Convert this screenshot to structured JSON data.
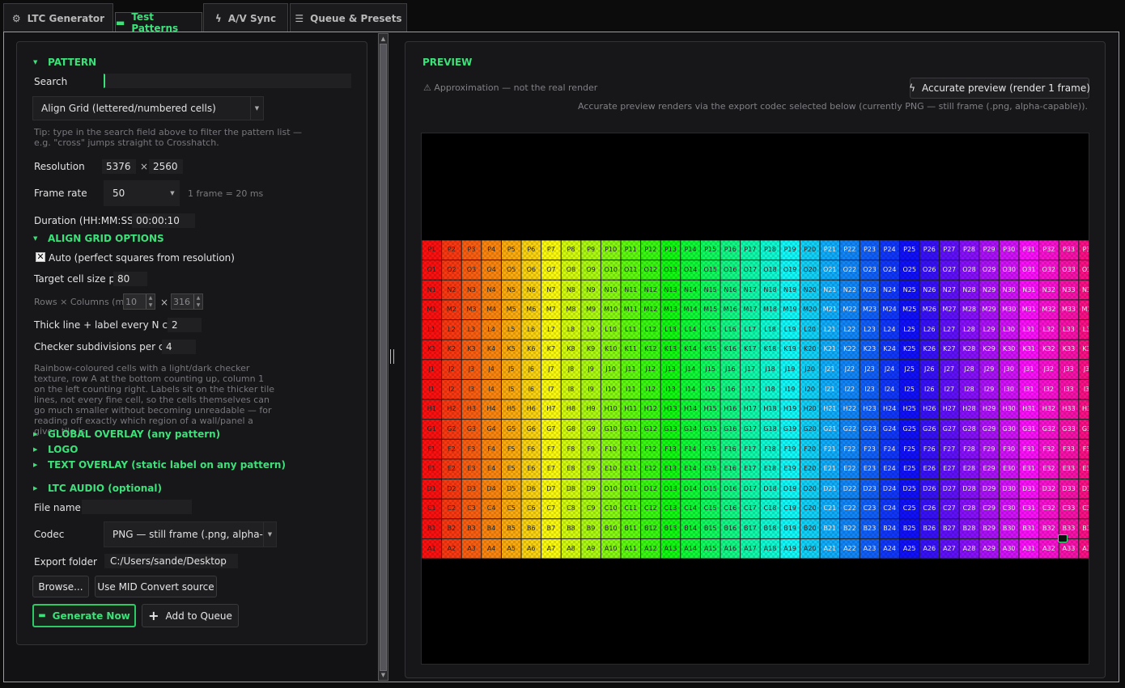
{
  "tabs": [
    {
      "label": "LTC Generator",
      "icon": "gear-icon",
      "active": false
    },
    {
      "label": "Test Patterns",
      "icon": "pattern-icon",
      "active": true
    },
    {
      "label": "A/V Sync",
      "icon": "bolt-icon",
      "active": false
    },
    {
      "label": "Queue & Presets",
      "icon": "list-icon",
      "active": false
    }
  ],
  "pattern": {
    "section_title": "PATTERN",
    "search_label": "Search",
    "search_value": "",
    "pattern_select": "Align Grid (lettered/numbered cells)",
    "tip": "Tip: type in the search field above to filter the pattern list — e.g. \"cross\" jumps straight to Crosshatch.",
    "resolution_label": "Resolution",
    "res_w": "5376",
    "res_x": "×",
    "res_h": "2560",
    "framerate_label": "Frame rate",
    "framerate": "50",
    "frame_hint": "1 frame = 20 ms",
    "duration_label": "Duration (HH:MM:SS)",
    "duration": "00:00:10"
  },
  "align": {
    "section_title": "ALIGN GRID OPTIONS",
    "auto_label": "Auto (perfect squares from resolution)",
    "auto_checked": true,
    "target_label": "Target cell size px",
    "target_value": "80",
    "rowscols_label": "Rows × Columns (ma",
    "rows": "10",
    "cols_x": "×",
    "cols": "316",
    "thick_label": "Thick line + label every N cells",
    "thick_value": "2",
    "checker_label": "Checker subdivisions per cell",
    "checker_value": "4",
    "description": "Rainbow-coloured cells with a light/dark checker texture, row A at the bottom counting up, column 1 on the left counting right. Labels sit on the thicker tile lines, not every fine cell, so the cells themselves can go much smaller without becoming unreadable — for reading off exactly which region of a wall/panel a given tile is."
  },
  "collapsed_sections": [
    "GLOBAL OVERLAY (any pattern)",
    "LOGO",
    "TEXT OVERLAY (static label on any pattern)"
  ],
  "ltc": {
    "section_title": "LTC AUDIO (optional)",
    "filename_label": "File name",
    "filename_value": "",
    "codec_label": "Codec",
    "codec_value": "PNG — still frame (.png, alpha-cap",
    "export_label": "Export folder",
    "export_value": "C:/Users/sande/Desktop",
    "browse_btn": "Browse...",
    "mid_btn": "Use MID Convert source",
    "generate_btn": "Generate Now",
    "queue_btn": "Add to Queue"
  },
  "preview": {
    "title": "PREVIEW",
    "approx": "Approximation — not the real render",
    "accurate_btn": "Accurate preview (render 1 frame)",
    "accurate_note": "Accurate preview renders via the export codec selected below (currently PNG — still frame (.png, alpha-capable))."
  },
  "grid_preview": {
    "rows": [
      "P",
      "O",
      "N",
      "M",
      "L",
      "K",
      "J",
      "I",
      "H",
      "G",
      "F",
      "E",
      "D",
      "C",
      "B",
      "A"
    ],
    "visible_columns": 33,
    "hue_start": 0,
    "hue_end": 330
  }
}
